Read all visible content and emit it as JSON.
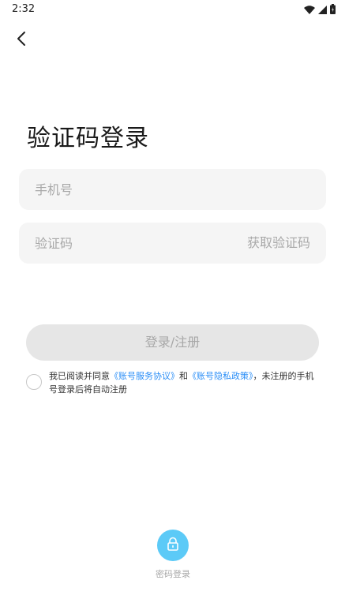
{
  "status_bar": {
    "time": "2:32"
  },
  "header": {
    "back_icon": "chevron-left-icon"
  },
  "page": {
    "title": "验证码登录"
  },
  "form": {
    "phone_placeholder": "手机号",
    "code_placeholder": "验证码",
    "get_code_label": "获取验证码",
    "submit_label": "登录/注册"
  },
  "agreement": {
    "prefix": "我已阅读并同意",
    "service_link": "《账号服务协议》",
    "connector": "和",
    "privacy_link": "《账号隐私政策》",
    "suffix": "，未注册的手机号登录后将自动注册"
  },
  "alt_login": {
    "icon": "lock-icon",
    "label": "密码登录"
  },
  "colors": {
    "accent": "#2a8ef7",
    "lock_bg": "#5ccaf7",
    "field_bg": "#f5f5f5",
    "button_disabled_bg": "#e6e6e6",
    "muted_text": "#a8a8a8"
  }
}
